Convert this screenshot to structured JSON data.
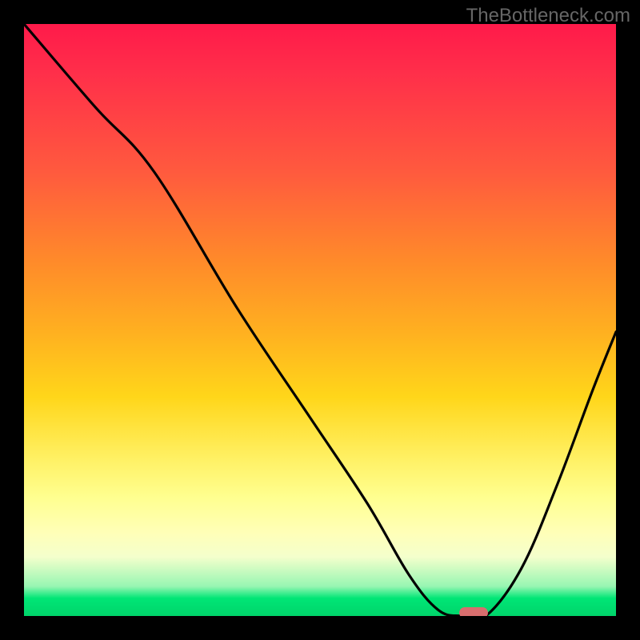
{
  "watermark": "TheBottleneck.com",
  "chart_data": {
    "type": "line",
    "title": "",
    "xlabel": "",
    "ylabel": "",
    "xlim": [
      0,
      100
    ],
    "ylim": [
      0,
      100
    ],
    "grid": false,
    "legend": false,
    "series": [
      {
        "name": "curve",
        "x": [
          0,
          12,
          22,
          36,
          48,
          58,
          65,
          70,
          74,
          78,
          84,
          90,
          96,
          100
        ],
        "values": [
          100,
          86,
          75,
          52,
          34,
          19,
          7,
          1,
          0,
          0,
          8,
          22,
          38,
          48
        ]
      }
    ],
    "annotations": [
      {
        "name": "marker",
        "x": 76,
        "y": 0.5,
        "shape": "pill",
        "color": "#d86e6e"
      }
    ],
    "background": {
      "type": "vertical-gradient",
      "stops": [
        {
          "pos": 0,
          "color": "#ff1a4a"
        },
        {
          "pos": 25,
          "color": "#ff5a3e"
        },
        {
          "pos": 52,
          "color": "#ffb020"
        },
        {
          "pos": 74,
          "color": "#fff268"
        },
        {
          "pos": 90,
          "color": "#f4ffcc"
        },
        {
          "pos": 100,
          "color": "#00d46a"
        }
      ]
    }
  }
}
